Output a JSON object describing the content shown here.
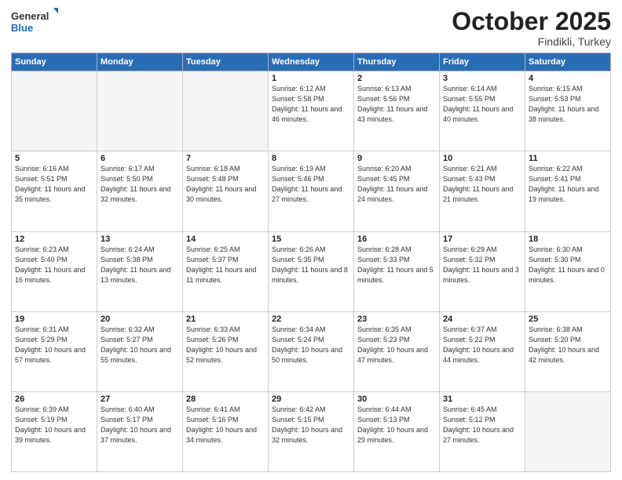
{
  "header": {
    "logo_general": "General",
    "logo_blue": "Blue",
    "month": "October 2025",
    "location": "Findikli, Turkey"
  },
  "weekdays": [
    "Sunday",
    "Monday",
    "Tuesday",
    "Wednesday",
    "Thursday",
    "Friday",
    "Saturday"
  ],
  "weeks": [
    [
      {
        "day": "",
        "info": ""
      },
      {
        "day": "",
        "info": ""
      },
      {
        "day": "",
        "info": ""
      },
      {
        "day": "1",
        "info": "Sunrise: 6:12 AM\nSunset: 5:58 PM\nDaylight: 11 hours and 46 minutes."
      },
      {
        "day": "2",
        "info": "Sunrise: 6:13 AM\nSunset: 5:56 PM\nDaylight: 11 hours and 43 minutes."
      },
      {
        "day": "3",
        "info": "Sunrise: 6:14 AM\nSunset: 5:55 PM\nDaylight: 11 hours and 40 minutes."
      },
      {
        "day": "4",
        "info": "Sunrise: 6:15 AM\nSunset: 5:53 PM\nDaylight: 11 hours and 38 minutes."
      }
    ],
    [
      {
        "day": "5",
        "info": "Sunrise: 6:16 AM\nSunset: 5:51 PM\nDaylight: 11 hours and 35 minutes."
      },
      {
        "day": "6",
        "info": "Sunrise: 6:17 AM\nSunset: 5:50 PM\nDaylight: 11 hours and 32 minutes."
      },
      {
        "day": "7",
        "info": "Sunrise: 6:18 AM\nSunset: 5:48 PM\nDaylight: 11 hours and 30 minutes."
      },
      {
        "day": "8",
        "info": "Sunrise: 6:19 AM\nSunset: 5:46 PM\nDaylight: 11 hours and 27 minutes."
      },
      {
        "day": "9",
        "info": "Sunrise: 6:20 AM\nSunset: 5:45 PM\nDaylight: 11 hours and 24 minutes."
      },
      {
        "day": "10",
        "info": "Sunrise: 6:21 AM\nSunset: 5:43 PM\nDaylight: 11 hours and 21 minutes."
      },
      {
        "day": "11",
        "info": "Sunrise: 6:22 AM\nSunset: 5:41 PM\nDaylight: 11 hours and 19 minutes."
      }
    ],
    [
      {
        "day": "12",
        "info": "Sunrise: 6:23 AM\nSunset: 5:40 PM\nDaylight: 11 hours and 16 minutes."
      },
      {
        "day": "13",
        "info": "Sunrise: 6:24 AM\nSunset: 5:38 PM\nDaylight: 11 hours and 13 minutes."
      },
      {
        "day": "14",
        "info": "Sunrise: 6:25 AM\nSunset: 5:37 PM\nDaylight: 11 hours and 11 minutes."
      },
      {
        "day": "15",
        "info": "Sunrise: 6:26 AM\nSunset: 5:35 PM\nDaylight: 11 hours and 8 minutes."
      },
      {
        "day": "16",
        "info": "Sunrise: 6:28 AM\nSunset: 5:33 PM\nDaylight: 11 hours and 5 minutes."
      },
      {
        "day": "17",
        "info": "Sunrise: 6:29 AM\nSunset: 5:32 PM\nDaylight: 11 hours and 3 minutes."
      },
      {
        "day": "18",
        "info": "Sunrise: 6:30 AM\nSunset: 5:30 PM\nDaylight: 11 hours and 0 minutes."
      }
    ],
    [
      {
        "day": "19",
        "info": "Sunrise: 6:31 AM\nSunset: 5:29 PM\nDaylight: 10 hours and 57 minutes."
      },
      {
        "day": "20",
        "info": "Sunrise: 6:32 AM\nSunset: 5:27 PM\nDaylight: 10 hours and 55 minutes."
      },
      {
        "day": "21",
        "info": "Sunrise: 6:33 AM\nSunset: 5:26 PM\nDaylight: 10 hours and 52 minutes."
      },
      {
        "day": "22",
        "info": "Sunrise: 6:34 AM\nSunset: 5:24 PM\nDaylight: 10 hours and 50 minutes."
      },
      {
        "day": "23",
        "info": "Sunrise: 6:35 AM\nSunset: 5:23 PM\nDaylight: 10 hours and 47 minutes."
      },
      {
        "day": "24",
        "info": "Sunrise: 6:37 AM\nSunset: 5:22 PM\nDaylight: 10 hours and 44 minutes."
      },
      {
        "day": "25",
        "info": "Sunrise: 6:38 AM\nSunset: 5:20 PM\nDaylight: 10 hours and 42 minutes."
      }
    ],
    [
      {
        "day": "26",
        "info": "Sunrise: 6:39 AM\nSunset: 5:19 PM\nDaylight: 10 hours and 39 minutes."
      },
      {
        "day": "27",
        "info": "Sunrise: 6:40 AM\nSunset: 5:17 PM\nDaylight: 10 hours and 37 minutes."
      },
      {
        "day": "28",
        "info": "Sunrise: 6:41 AM\nSunset: 5:16 PM\nDaylight: 10 hours and 34 minutes."
      },
      {
        "day": "29",
        "info": "Sunrise: 6:42 AM\nSunset: 5:15 PM\nDaylight: 10 hours and 32 minutes."
      },
      {
        "day": "30",
        "info": "Sunrise: 6:44 AM\nSunset: 5:13 PM\nDaylight: 10 hours and 29 minutes."
      },
      {
        "day": "31",
        "info": "Sunrise: 6:45 AM\nSunset: 5:12 PM\nDaylight: 10 hours and 27 minutes."
      },
      {
        "day": "",
        "info": ""
      }
    ]
  ]
}
